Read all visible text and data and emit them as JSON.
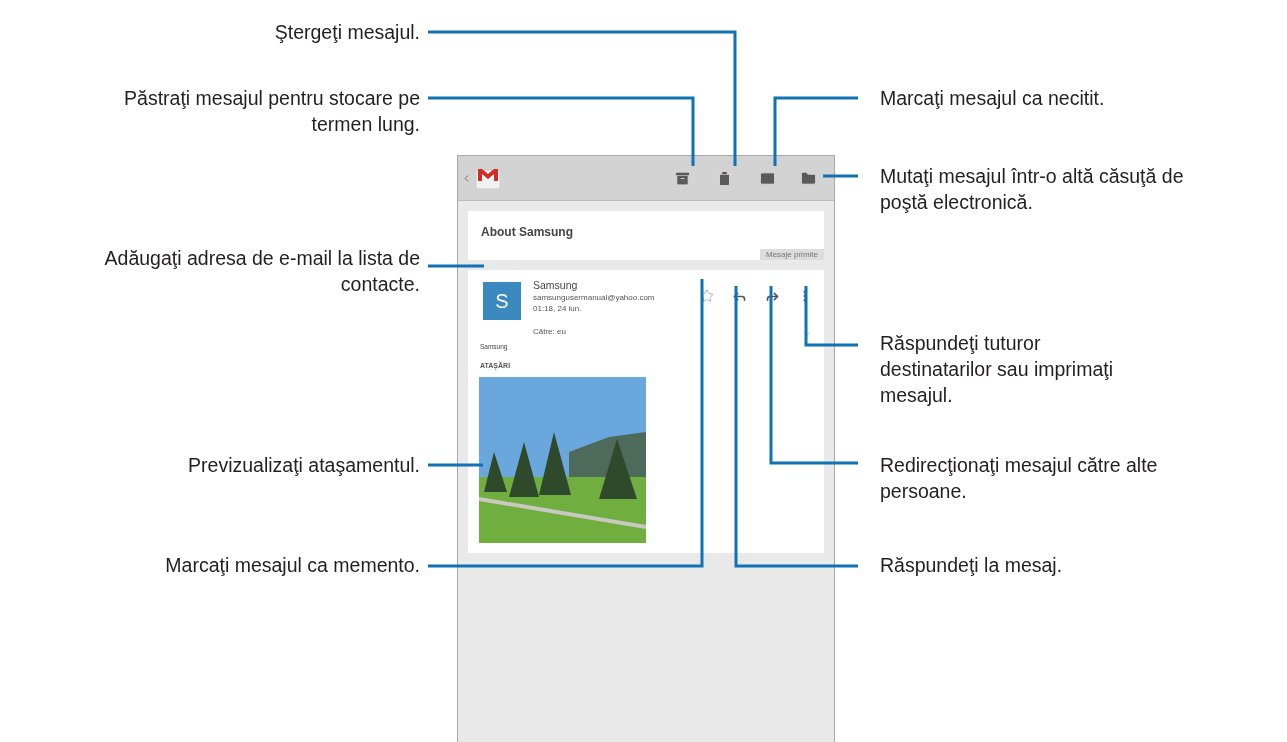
{
  "left_callouts": [
    "Ştergeţi mesajul.",
    "Păstraţi mesajul pentru stocare pe termen lung.",
    "Adăugaţi adresa de e-mail la lista de contacte.",
    "Previzualizaţi ataşamentul.",
    "Marcaţi mesajul ca memento."
  ],
  "right_callouts": [
    "Marcaţi mesajul ca necitit.",
    "Mutaţi mesajul într-o altă căsuţă de poştă electronică.",
    "Răspundeţi tuturor destinatarilor sau imprimaţi mesajul.",
    "Redirecţionaţi mesajul către alte persoane.",
    "Răspundeţi la mesaj."
  ],
  "screen": {
    "subject": "About Samsung",
    "label": "Mesaje primite",
    "message": {
      "avatar_letter": "S",
      "sender": "Samsung",
      "email": "samsungusermanual@yahoo.com",
      "time": "01:18, 24 iun.",
      "to": "Către: eu",
      "starred": false,
      "body": "Samsung",
      "attachments_heading": "ATAŞĂRI"
    }
  }
}
